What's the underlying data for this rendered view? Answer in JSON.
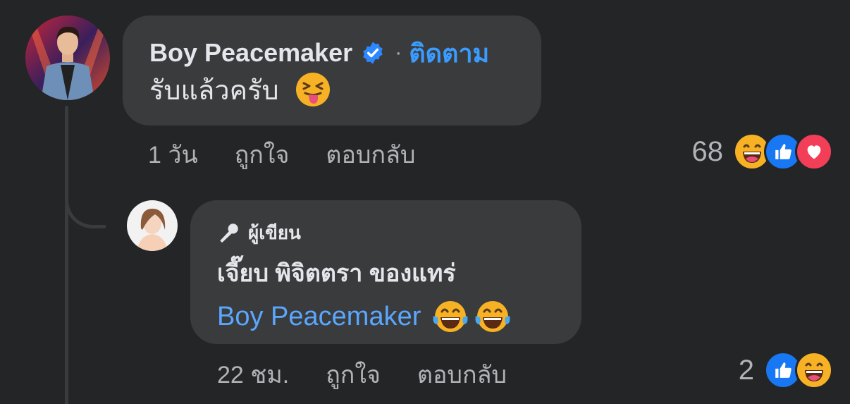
{
  "comments": [
    {
      "author": "Boy Peacemaker",
      "follow_label": "ติดตาม",
      "separator": "·",
      "text": "รับแล้วครับ",
      "time": "1 วัน",
      "like_label": "ถูกใจ",
      "reply_label": "ตอบกลับ",
      "reaction_count": "68",
      "reactions": [
        "haha-icon",
        "like-icon",
        "love-icon"
      ]
    },
    {
      "author_badge": "ผู้เขียน",
      "author": "เจี๊ยบ พิจิตตรา ของแทร่",
      "mention": "Boy Peacemaker",
      "time": "22 ชม.",
      "like_label": "ถูกใจ",
      "reply_label": "ตอบกลับ",
      "reaction_count": "2",
      "reactions": [
        "like-icon",
        "haha-icon"
      ]
    }
  ],
  "colors": {
    "background": "#242526",
    "bubble": "#3a3b3c",
    "link_blue": "#3a9cff",
    "mention_blue": "#5aa7ff",
    "like_blue": "#1877f2",
    "love_red": "#f33e58",
    "haha_yellow": "#f7b125"
  }
}
